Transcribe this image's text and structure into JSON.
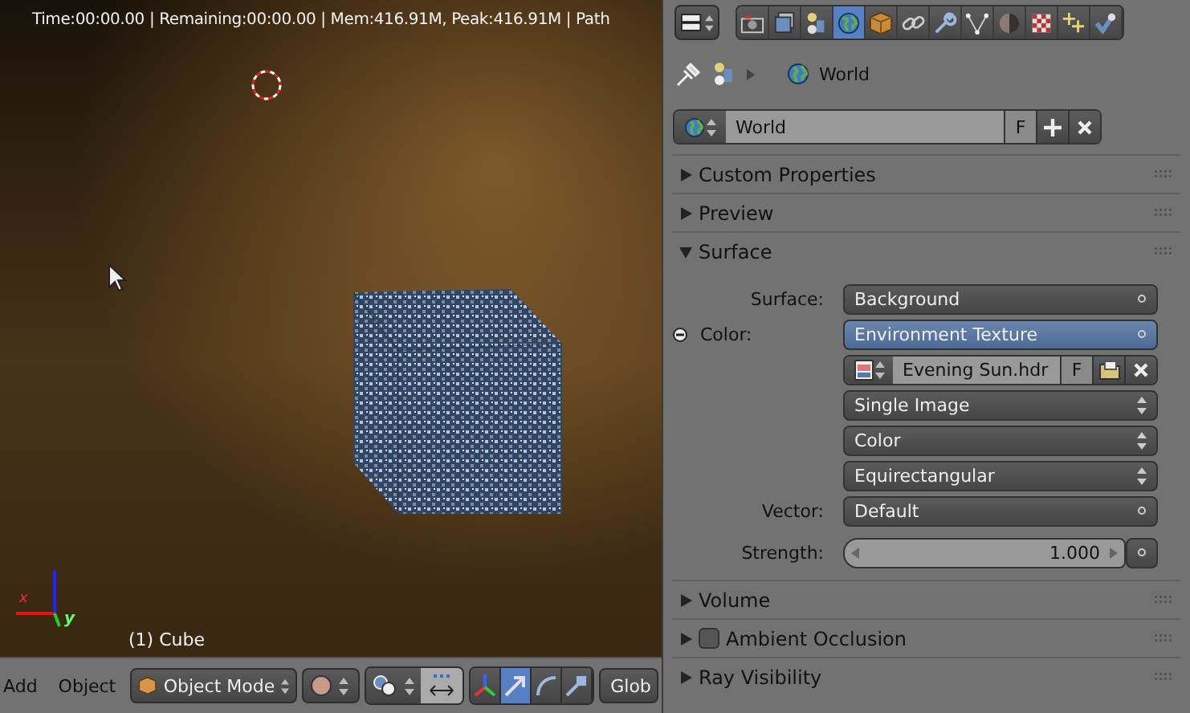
{
  "viewport": {
    "render_stats": "Time:00:00.00 | Remaining:00:00.00 | Mem:416.91M, Peak:416.91M | Path",
    "object_label": "(1) Cube",
    "axes": [
      {
        "label": "x"
      },
      {
        "label": "y"
      }
    ]
  },
  "viewport_header": {
    "menus": [
      "Add",
      "Object"
    ],
    "mode": "Object Mode",
    "orientation": "Glob",
    "manipulators": [
      {
        "kind": "combined",
        "selected": false
      },
      {
        "kind": "translate",
        "selected": true
      },
      {
        "kind": "rotate",
        "selected": false
      },
      {
        "kind": "scale",
        "selected": false
      }
    ]
  },
  "properties": {
    "tabs": [
      {
        "kind": "render",
        "selected": false
      },
      {
        "kind": "layers",
        "selected": false
      },
      {
        "kind": "scene",
        "selected": false
      },
      {
        "kind": "world",
        "selected": true
      },
      {
        "kind": "object",
        "selected": false
      },
      {
        "kind": "constraints",
        "selected": false
      },
      {
        "kind": "modifiers",
        "selected": false
      },
      {
        "kind": "data",
        "selected": false
      },
      {
        "kind": "material",
        "selected": false
      },
      {
        "kind": "texture",
        "selected": false
      },
      {
        "kind": "particles",
        "selected": false
      },
      {
        "kind": "physics",
        "selected": false
      }
    ],
    "breadcrumb": "World",
    "datablock": {
      "name": "World",
      "fake_user": "F"
    },
    "panels": [
      {
        "title": "Custom Properties",
        "expanded": false
      },
      {
        "title": "Preview",
        "expanded": false
      },
      {
        "title": "Surface",
        "expanded": true,
        "fields": [
          {
            "kind": "node",
            "label": "Surface:",
            "value": "Background",
            "linked": false
          },
          {
            "kind": "node",
            "label": "Color:",
            "value": "Environment Texture",
            "linked": true
          },
          {
            "kind": "image",
            "value": "Evening Sun.hdr",
            "fake_user": "F"
          },
          {
            "kind": "menu",
            "value": "Single Image"
          },
          {
            "kind": "menu",
            "value": "Color"
          },
          {
            "kind": "menu",
            "value": "Equirectangular"
          },
          {
            "kind": "node",
            "label": "Vector:",
            "value": "Default",
            "linked": false
          },
          {
            "kind": "number",
            "label": "Strength:",
            "value": "1.000"
          }
        ]
      },
      {
        "title": "Volume",
        "expanded": false
      },
      {
        "title": "Ambient Occlusion",
        "expanded": false,
        "checked": false
      },
      {
        "title": "Ray Visibility",
        "expanded": false
      }
    ]
  }
}
